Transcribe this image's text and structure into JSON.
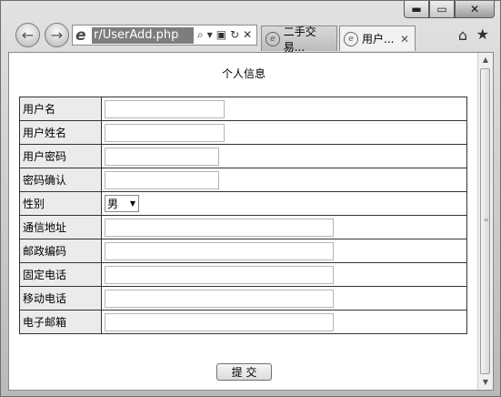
{
  "browser": {
    "address": "r/UserAdd.php",
    "tabs": [
      {
        "label": "二手交易...",
        "active": false
      },
      {
        "label": "用户...",
        "active": true
      }
    ],
    "controls": {
      "minimize": "▬",
      "maximize": "▭",
      "close": "✕"
    }
  },
  "page": {
    "title": "个人信息",
    "fields": [
      {
        "label": "用户名",
        "value": "",
        "type": "text"
      },
      {
        "label": "用户姓名",
        "value": "",
        "type": "text"
      },
      {
        "label": "用户密码",
        "value": "",
        "type": "password"
      },
      {
        "label": "密码确认",
        "value": "",
        "type": "password"
      },
      {
        "label": "性别",
        "value": "男",
        "type": "select"
      },
      {
        "label": "通信地址",
        "value": "",
        "type": "text"
      },
      {
        "label": "邮政编码",
        "value": "",
        "type": "text"
      },
      {
        "label": "固定电话",
        "value": "",
        "type": "text"
      },
      {
        "label": "移动电话",
        "value": "",
        "type": "text"
      },
      {
        "label": "电子邮箱",
        "value": "",
        "type": "text"
      }
    ],
    "submit_label": "提 交"
  }
}
